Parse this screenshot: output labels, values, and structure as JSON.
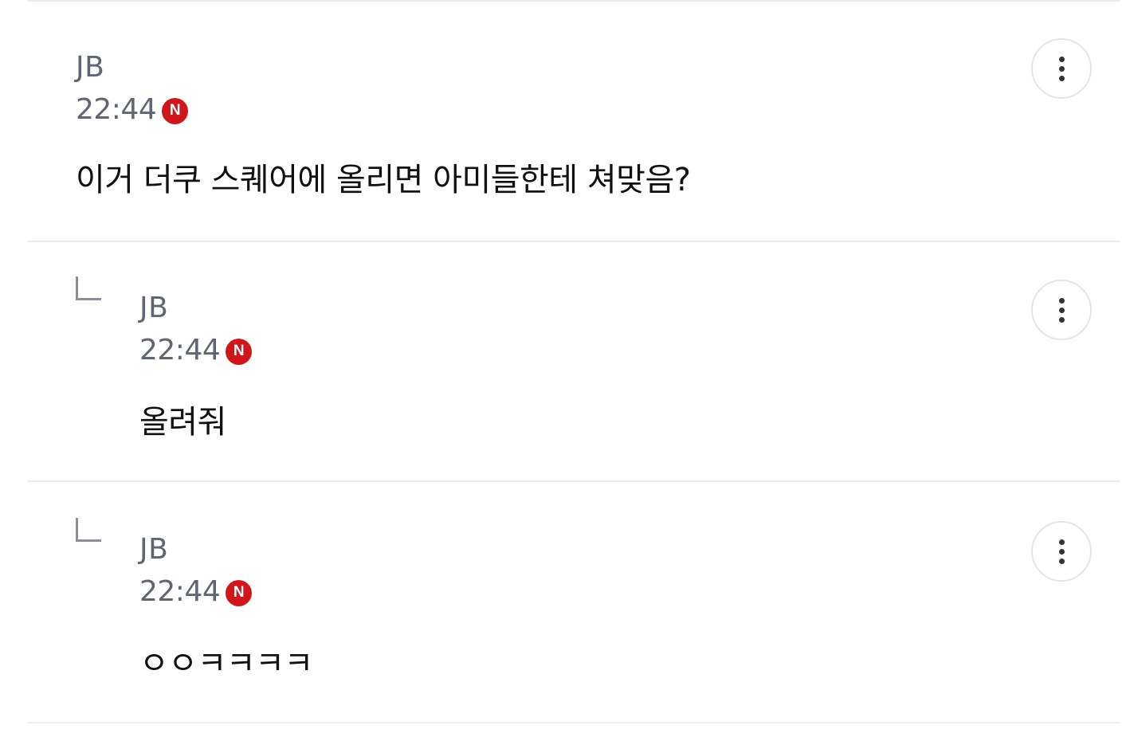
{
  "comments": [
    {
      "author": "JB",
      "time": "22:44",
      "badge": "N",
      "text": "이거 더쿠 스퀘어에 올리면 아미들한테 쳐맞음?",
      "is_reply": false
    },
    {
      "author": "JB",
      "time": "22:44",
      "badge": "N",
      "text": "올려줘",
      "is_reply": true
    },
    {
      "author": "JB",
      "time": "22:44",
      "badge": "N",
      "text": "ㅇㅇㅋㅋㅋㅋ",
      "is_reply": true
    }
  ],
  "icons": {
    "more": "more-vertical-icon",
    "reply": "reply-arrow-icon",
    "new": "new-badge-icon"
  },
  "colors": {
    "badge": "#d0161a",
    "meta_text": "#5f6672",
    "body_text": "#111111",
    "divider": "#ececec"
  }
}
